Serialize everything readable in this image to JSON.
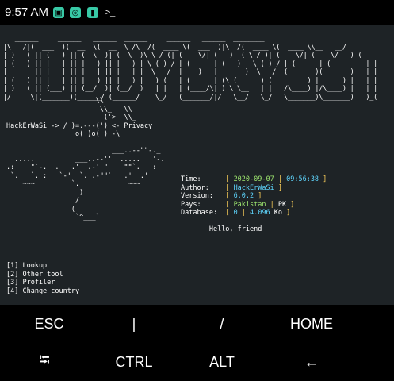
{
  "status_bar": {
    "time": "9:57 AM",
    "icons": [
      "screenshot-icon",
      "hotspot-icon",
      "battery-saver-icon",
      "terminal-icon"
    ],
    "icon_colors": [
      "#38c9a6",
      "#38c9a6",
      "#38c9a6",
      "#ffffff"
    ]
  },
  "terminal": {
    "banner_lines": [
      "   ______     ______   ______  ______     ______   ______  ________",
      "|\\   /|(  ___  )(  __  \\(  __  \\ /\\  /(  ____ \\(  ___  )|\\  /(  ____ \\(  ____ \\\\__   __/",
      "| )   ( || (   ) || (  \\  )| (  \\  )\\ \\ / (| (    \\/| (   ) |( \\ / )| (    \\/| (    \\/   ) (",
      "| (___) || |   | || |   ) || |   ) | \\ (_) / | (__    | (___) | \\ (_) / | (_____ | (_____    | |",
      "|  ___  || |   | || |   | || |   | |  \\   /  |  __)   |     __)  \\   /  (_____  )(_____  )   | |",
      "| (   ) || |   | || |   ) || |   ) |   ) (   | (      | (\\ (      ) (         ) |      ) |   | |",
      "| )   ( || (___) || (__/  )| (__/  )   | |   | (____/\\| ) \\ \\__   | |   /\\____) |/\\____) |   | |",
      "|/     \\|(_______)(______/ (______/    \\_/   (_______/|/   \\__/   \\_/   \\_______)\\_______)   )_("
    ],
    "privacy_art": [
      "                      \\\\",
      "                       \\\\_   \\\\",
      "                        ('>  \\\\_",
      "HackErWaSi -> / )=.---(') <- Privacy",
      "                 o( )o( )_-\\_"
    ],
    "map_art": [
      "",
      "                          ___..--\"\"-._",
      "  .....          ___..--''  .....   '-.",
      ".:    \"`-.  .   .'  .-' \"    \"\"`.   :",
      " `._  `._:   `-'  `._.-\"\"`   .'  .'",
      "    ~~~         `.            ~~~",
      "                  )",
      "                 /",
      "                (",
      "                 `^___`"
    ],
    "info_labels": [
      "Time:",
      "Author:",
      "Version:",
      "Pays:",
      "Database:"
    ],
    "info": {
      "time_date": "2020-09-07",
      "time_clock": "09:56:38",
      "author": "HackErWaSi",
      "version": "6.0.2",
      "country": "Pakistan",
      "country_code": "PK",
      "db_count": "0",
      "db_size": "4.096",
      "db_unit": "Ko"
    },
    "greeting": "Hello, friend",
    "menu": [
      "[1] Lookup",
      "[2] Other tool",
      "[3] Profiler",
      "[4] Change country"
    ]
  },
  "extra_keys": {
    "row1": [
      "ESC",
      "|",
      "/",
      "HOME"
    ],
    "row2": [
      "⭾",
      "CTRL",
      "ALT",
      "←"
    ]
  }
}
